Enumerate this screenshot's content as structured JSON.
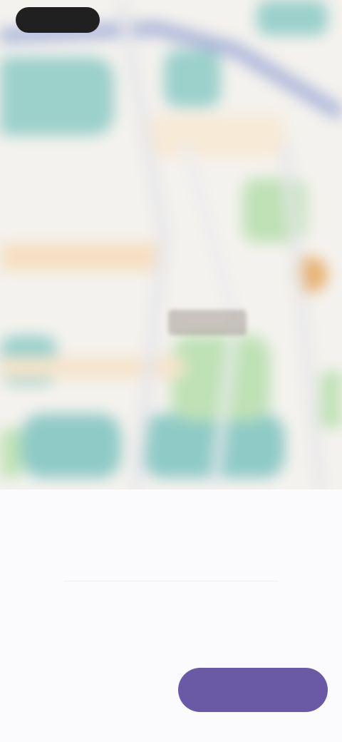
{
  "status_bar": {
    "pill_label": ""
  },
  "map": {
    "place_label": ""
  },
  "stats": {
    "row1": {
      "left": {
        "caption": "",
        "value": ""
      },
      "right": {
        "caption": "",
        "value": ""
      }
    },
    "row2": {
      "left": {
        "caption": "",
        "value": ""
      },
      "right": {
        "caption": "",
        "value": ""
      }
    }
  },
  "actions": {
    "secondary_label": "",
    "primary_label": ""
  },
  "colors": {
    "primary": "#6a5aa6",
    "water": "#8fcac6",
    "park": "#b6dcae",
    "road": "#f3d9b8"
  }
}
